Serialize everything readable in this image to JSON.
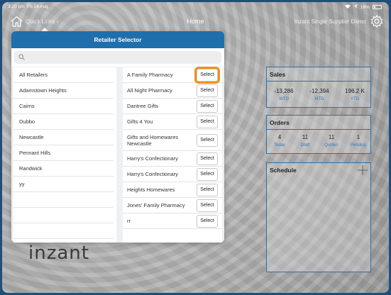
{
  "status": {
    "time": "3:20 pm",
    "date": "Fri 14 Aug",
    "battery": "16%"
  },
  "nav": {
    "quick_links": "Quick Links ›",
    "title": "Home",
    "store": "Inzant Single Supplier Demo"
  },
  "popover": {
    "title": "Retailer Selector",
    "search_placeholder": "",
    "left_items": [
      "All Retailers",
      "Adamstown Heights",
      "Cairns",
      "Dubbo",
      "Newcastle",
      "Pennant Hills",
      "Randwick",
      "yy",
      "",
      "",
      "",
      ""
    ],
    "right_items": [
      {
        "name": "A Family Pharmacy",
        "button": "Select"
      },
      {
        "name": "All Night Pharmacy",
        "button": "Select"
      },
      {
        "name": "Dantree Gifts",
        "button": "Select"
      },
      {
        "name": "Gifts 4 You",
        "button": "Select"
      },
      {
        "name": "Gifts and Homewares Newcastle",
        "button": "Select"
      },
      {
        "name": "Harry's Confectionary",
        "button": "Select"
      },
      {
        "name": "Harry's Confectionary",
        "button": "Select"
      },
      {
        "name": "Heights Homewares",
        "button": "Select"
      },
      {
        "name": "Jones' Family Pharmacy",
        "button": "Select"
      },
      {
        "name": "rr",
        "button": "Select"
      }
    ]
  },
  "sales": {
    "title": "Sales",
    "metrics": [
      {
        "value": "-13,286",
        "label": "WTD"
      },
      {
        "value": "-12,394",
        "label": "MTD"
      },
      {
        "value": "196.2 K",
        "label": "YTD"
      }
    ]
  },
  "orders": {
    "title": "Orders",
    "metrics": [
      {
        "value": "4",
        "label": "Today"
      },
      {
        "value": "11",
        "label": "Draft"
      },
      {
        "value": "11",
        "label": "Quotes"
      },
      {
        "value": "1",
        "label": "Pending"
      }
    ]
  },
  "schedule": {
    "title": "Schedule"
  },
  "logo": "inzant",
  "colors": {
    "accent": "#1f6fad",
    "highlight": "#f0901e",
    "link": "#2f7ac0"
  }
}
